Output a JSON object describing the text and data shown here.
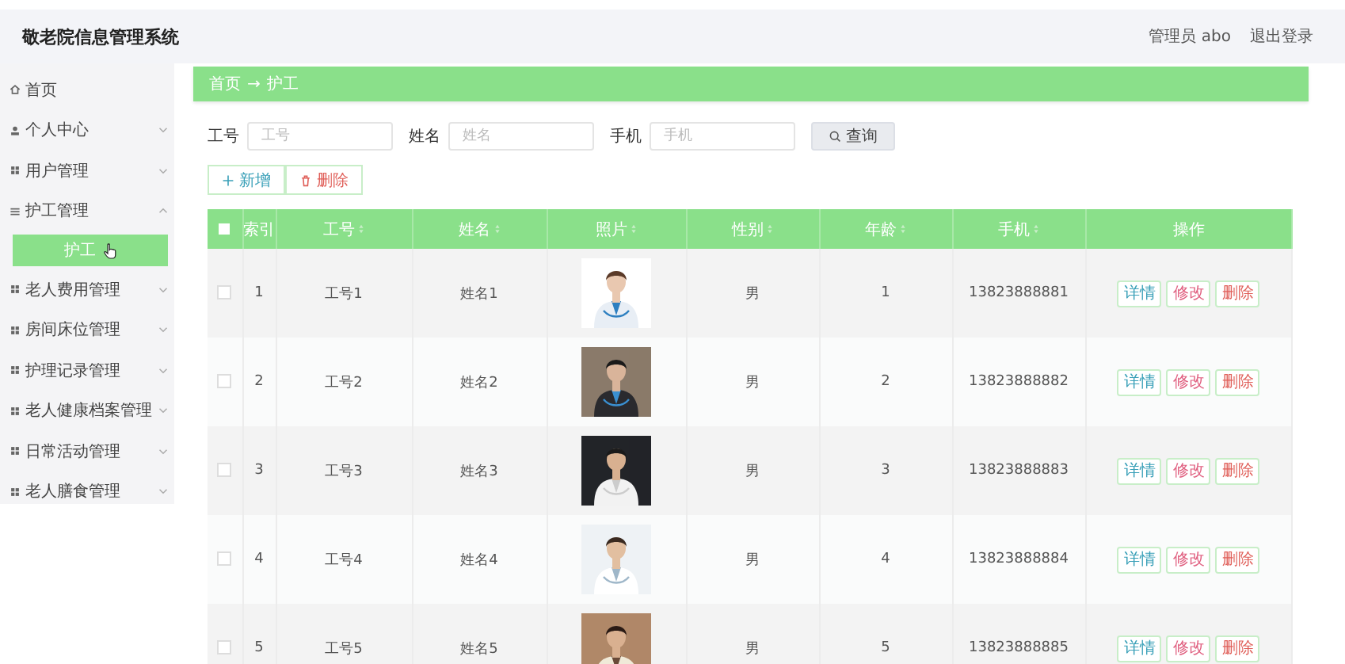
{
  "header": {
    "title": "敬老院信息管理系统",
    "user": "管理员 abo",
    "logout": "退出登录"
  },
  "sidebar": {
    "items": [
      {
        "label": "首页",
        "submenu": false
      },
      {
        "label": "个人中心",
        "submenu": true
      },
      {
        "label": "用户管理",
        "submenu": true
      },
      {
        "label": "护工管理",
        "submenu": true,
        "expanded": true,
        "children": [
          {
            "label": "护工",
            "selected": true
          }
        ]
      },
      {
        "label": "老人费用管理",
        "submenu": true
      },
      {
        "label": "房间床位管理",
        "submenu": true
      },
      {
        "label": "护理记录管理",
        "submenu": true
      },
      {
        "label": "老人健康档案管理",
        "submenu": true
      },
      {
        "label": "日常活动管理",
        "submenu": true
      },
      {
        "label": "老人膳食管理",
        "submenu": true
      }
    ]
  },
  "breadcrumb": [
    "首页",
    "→",
    "护工"
  ],
  "search": {
    "fields": [
      {
        "label": "工号",
        "placeholder": "工号"
      },
      {
        "label": "姓名",
        "placeholder": "姓名"
      },
      {
        "label": "手机",
        "placeholder": "手机"
      }
    ],
    "button": "查询"
  },
  "actions": [
    {
      "label": "新增",
      "kind": "add"
    },
    {
      "label": "删除",
      "kind": "delete"
    }
  ],
  "table": {
    "select_all": {
      "checked": false
    },
    "columns": [
      {
        "label": "索引",
        "sortable": false
      },
      {
        "label": "工号",
        "sortable": true
      },
      {
        "label": "姓名",
        "sortable": true
      },
      {
        "label": "照片",
        "sortable": true
      },
      {
        "label": "性别",
        "sortable": true
      },
      {
        "label": "年龄",
        "sortable": true
      },
      {
        "label": "手机",
        "sortable": true
      },
      {
        "label": "操作",
        "sortable": false
      }
    ],
    "rows": [
      {
        "checked": false,
        "index": "1",
        "id": "工号1",
        "name": "姓名1",
        "gender": "男",
        "age": "1",
        "phone": "13823888881",
        "buttons": [
          "详情",
          "修改",
          "删除"
        ]
      },
      {
        "checked": false,
        "index": "2",
        "id": "工号2",
        "name": "姓名2",
        "gender": "男",
        "age": "2",
        "phone": "13823888882",
        "buttons": [
          "详情",
          "修改",
          "删除"
        ]
      },
      {
        "checked": false,
        "index": "3",
        "id": "工号3",
        "name": "姓名3",
        "gender": "男",
        "age": "3",
        "phone": "13823888883",
        "buttons": [
          "详情",
          "修改",
          "删除"
        ]
      },
      {
        "checked": false,
        "index": "4",
        "id": "工号4",
        "name": "姓名4",
        "gender": "男",
        "age": "4",
        "phone": "13823888884",
        "buttons": [
          "详情",
          "修改",
          "删除"
        ]
      },
      {
        "checked": false,
        "index": "5",
        "id": "工号5",
        "name": "姓名5",
        "gender": "男",
        "age": "5",
        "phone": "13823888885",
        "buttons": [
          "详情",
          "修改",
          "删除"
        ]
      }
    ]
  }
}
